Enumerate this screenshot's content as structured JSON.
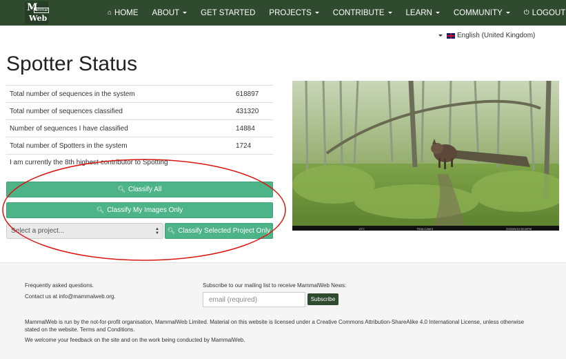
{
  "nav": {
    "logo_text": "MammalWeb",
    "items": [
      {
        "label": "HOME",
        "icon": "home-icon"
      },
      {
        "label": "ABOUT",
        "dropdown": true
      },
      {
        "label": "GET STARTED"
      },
      {
        "label": "PROJECTS",
        "dropdown": true
      },
      {
        "label": "CONTRIBUTE",
        "dropdown": true
      },
      {
        "label": "LEARN",
        "dropdown": true
      },
      {
        "label": "COMMUNITY",
        "dropdown": true
      },
      {
        "label": "LOGOUT",
        "icon": "power-icon"
      }
    ]
  },
  "language": {
    "label": "English (United Kingdom)"
  },
  "page": {
    "title": "Spotter Status"
  },
  "stats": [
    {
      "label": "Total number of sequences in the system",
      "value": "618897"
    },
    {
      "label": "Total number of sequences classified",
      "value": "431320"
    },
    {
      "label": "Number of sequences I have classified",
      "value": "14884"
    },
    {
      "label": "Total number of Spotters in the system",
      "value": "1724"
    }
  ],
  "rank_text": "I am currently the 8th highest contributor to Spotting",
  "buttons": {
    "classify_all": "Classify All",
    "classify_mine": "Classify My Images Only",
    "classify_selected": "Classify Selected Project Only"
  },
  "project_select": {
    "placeholder": "Select a project..."
  },
  "photo": {
    "overlay_left": "13°C",
    "overlay_mid": "TRAILCAM01",
    "overlay_right": "2020/05/10 08:00PM"
  },
  "footer": {
    "faq": "Frequently asked questions.",
    "contact": "Contact us at info@mammalweb.org.",
    "mailing": "Subscribe to our mailing list to receive MammalWeb News:",
    "email_placeholder": "email (required)",
    "subscribe": "Subscribe",
    "license": "MammalWeb is run by the not-for-profit organisation, MammalWeb Limited. Material on this website is licensed under a Creative Commons Attribution-ShareAlike 4.0 International License, unless otherwise stated on the website. Terms and Conditions.",
    "feedback": "We welcome your feedback on the site and on the work being conducted by MammalWeb."
  },
  "colors": {
    "navbar": "#2f4a2f",
    "button": "#4db388",
    "annotation": "#d9150f"
  }
}
